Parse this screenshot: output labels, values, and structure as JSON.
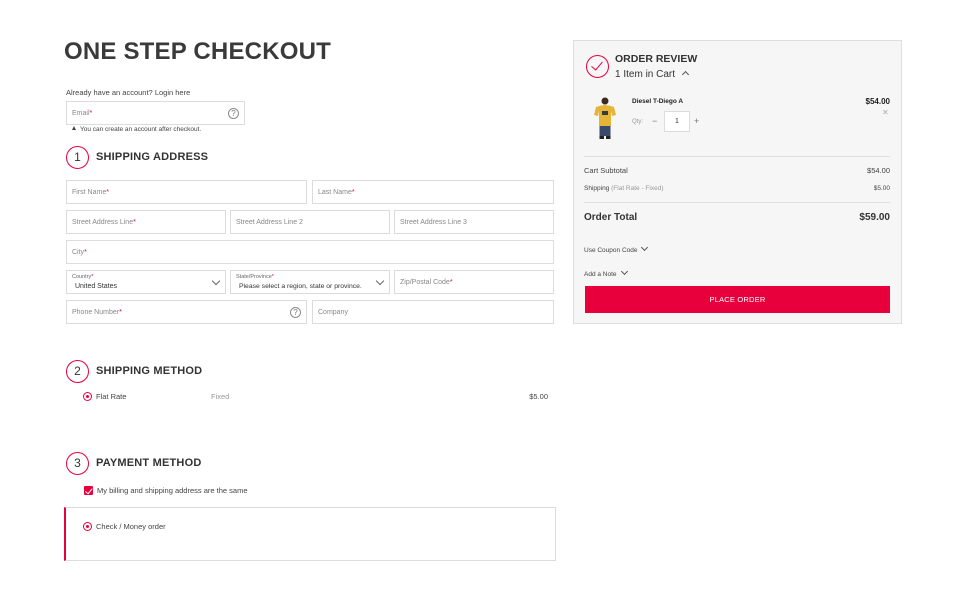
{
  "page_title": "ONE STEP CHECKOUT",
  "account": {
    "prompt": "Already have an account?",
    "login_link": "Login here",
    "email_placeholder": "Email",
    "required_mark": "*",
    "help_glyph": "?",
    "hint": "You can create an account after checkout."
  },
  "shipping_address": {
    "step": "1",
    "title": "SHIPPING ADDRESS",
    "first_name": "First Name",
    "last_name": "Last Name",
    "street1": "Street Address Line",
    "street2": "Street Address Line 2",
    "street3": "Street Address Line 3",
    "city": "City",
    "country_label": "Country",
    "country_value": "United States",
    "state_label": "State/Province",
    "state_value": "Please select a region, state or province.",
    "zip": "Zip/Postal Code",
    "phone": "Phone Number",
    "company": "Company"
  },
  "shipping_method": {
    "step": "2",
    "title": "SHIPPING METHOD",
    "option_name": "Flat Rate",
    "option_type": "Fixed",
    "option_price": "$5.00"
  },
  "payment_method": {
    "step": "3",
    "title": "PAYMENT METHOD",
    "same_address_label": "My billing and shipping address are the same",
    "same_address_checked": true,
    "option": "Check / Money order"
  },
  "order_review": {
    "title": "ORDER REVIEW",
    "items_count": "1 Item in Cart",
    "product": {
      "name": "Diesel T-Diego A",
      "price": "$54.00",
      "qty_label": "Qty:",
      "qty": "1",
      "minus": "−",
      "plus": "+",
      "remove": "✕"
    },
    "subtotal_label": "Cart Subtotal",
    "subtotal_value": "$54.00",
    "shipping_label": "Shipping",
    "shipping_detail": "(Flat Rate - Fixed)",
    "shipping_value": "$5.00",
    "total_label": "Order Total",
    "total_value": "$59.00",
    "coupon_link": "Use Coupon Code",
    "note_link": "Add a Note",
    "place_order": "PLACE ORDER"
  },
  "colors": {
    "accent": "#e8003d",
    "panel_bg": "#f6f6f6",
    "border": "#dcdcdc",
    "product_shirt": "#e5b53a"
  },
  "icons": {
    "review": "check-circle-icon",
    "help": "question-circle-icon",
    "select_arrow": "chevron-down-icon",
    "items_toggle": "chevron-up-icon"
  }
}
